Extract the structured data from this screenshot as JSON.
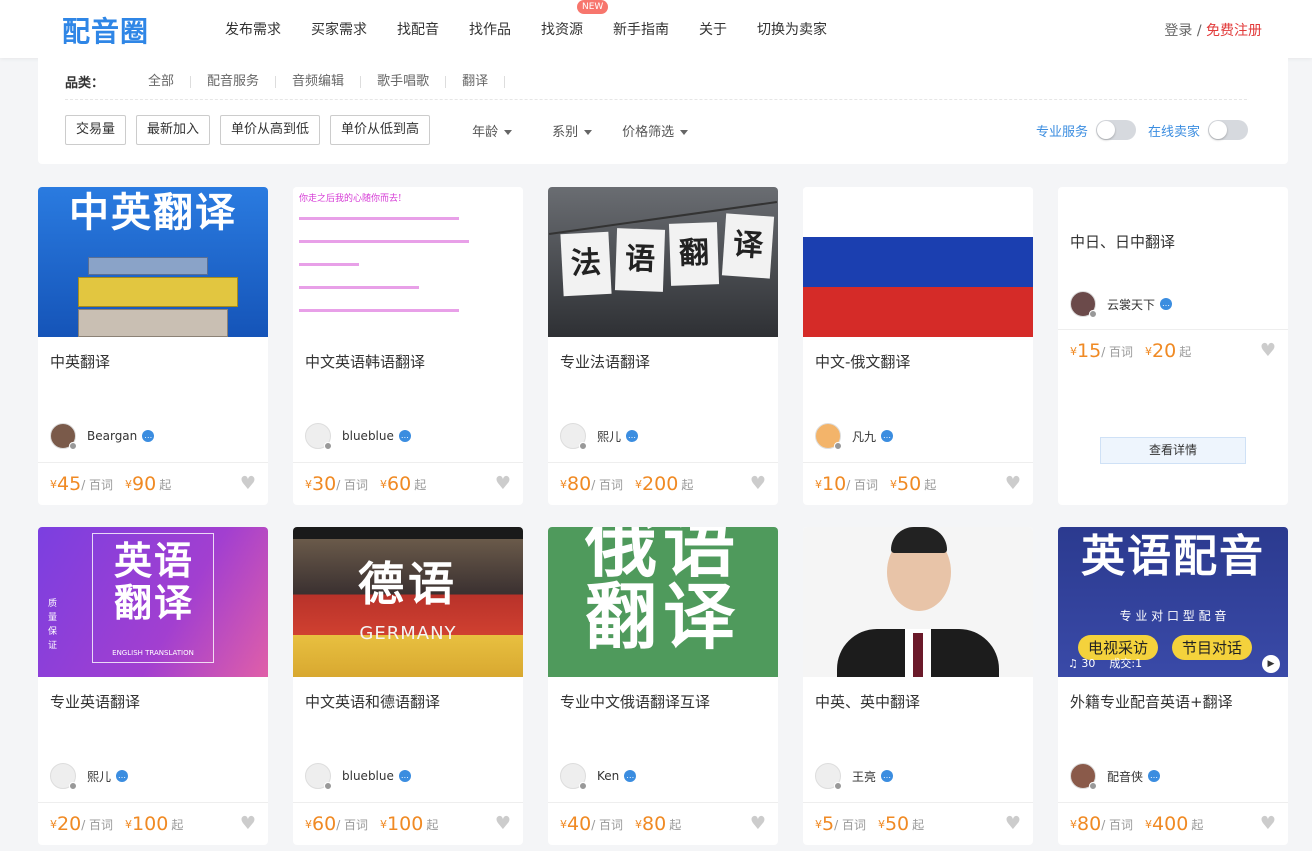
{
  "header": {
    "logo": "配音圈",
    "nav": [
      "发布需求",
      "买家需求",
      "找配音",
      "找作品",
      "找资源",
      "新手指南",
      "关于",
      "切换为卖家"
    ],
    "nav_badge": "NEW",
    "login": "登录",
    "separator": " / ",
    "register": "免费注册"
  },
  "filters": {
    "category_title": "品类：",
    "categories": [
      "全部",
      "配音服务",
      "音频编辑",
      "歌手唱歌",
      "翻译"
    ],
    "sort_buttons": [
      "交易量",
      "最新加入",
      "单价从高到低",
      "单价从低到高"
    ],
    "dropdowns": [
      "年龄",
      "系别",
      "价格筛选"
    ],
    "toggles": [
      "专业服务",
      "在线卖家"
    ]
  },
  "common": {
    "unit": "/ 百词",
    "qi": "起",
    "yen": "¥",
    "detail_button": "查看详情",
    "heart": "♥"
  },
  "cards": [
    {
      "title": "中英翻译",
      "seller": "Beargan",
      "price": "45",
      "start": "90",
      "thumb_text": "中英翻译",
      "thumb_bg": "#1d6fd3",
      "thumb_fg": "#ffffff"
    },
    {
      "title": "中文英语韩语翻译",
      "seller": "blueblue",
      "price": "30",
      "start": "60",
      "thumb_text": "你走之后我的心随你而去!",
      "thumb_bg": "#ffffff",
      "thumb_fg": "#d63ad6"
    },
    {
      "title": "专业法语翻译",
      "seller": "熙儿",
      "price": "80",
      "start": "200",
      "thumb_text": "法 语 翻 译",
      "thumb_bg": "#3d3f42",
      "thumb_fg": "#222222"
    },
    {
      "title": "中文-俄文翻译",
      "seller": "凡九",
      "price": "10",
      "start": "50",
      "thumb_text": "",
      "thumb_bg": "#ffffff",
      "thumb_fg": "#ffffff"
    },
    {
      "title": "中日、日中翻译",
      "seller": "云裳天下",
      "price": "15",
      "start": "20",
      "text_only": true
    },
    {
      "title": "专业英语翻译",
      "seller": "熙儿",
      "price": "20",
      "start": "100",
      "thumb_text": "英语翻译",
      "thumb_sub": "ENGLISH TRANSLATION",
      "thumb_side": "质量保证",
      "thumb_bg": "#8a3fd8",
      "thumb_fg": "#ffffff"
    },
    {
      "title": "中文英语和德语翻译",
      "seller": "blueblue",
      "price": "60",
      "start": "100",
      "thumb_text": "德语",
      "thumb_sub": "GERMANY",
      "thumb_bg": "#5a4a3a",
      "thumb_fg": "#ffffff"
    },
    {
      "title": "专业中文俄语翻译互译",
      "seller": "Ken",
      "price": "40",
      "start": "80",
      "thumb_text": "俄语翻译",
      "thumb_bg": "#4f9a5c",
      "thumb_fg": "#ffffff"
    },
    {
      "title": "中英、英中翻译",
      "seller": "王亮",
      "price": "5",
      "start": "50",
      "thumb_text": "",
      "thumb_bg": "#f2f2f2",
      "thumb_fg": "#333333"
    },
    {
      "title": "外籍专业配音英语+翻译",
      "seller": "配音侠",
      "price": "80",
      "start": "400",
      "thumb_text": "英语配音",
      "thumb_sub": "专 业 对 口 型 配 音",
      "thumb_tags": [
        "电视采访",
        "节目对话"
      ],
      "thumb_play": "30",
      "thumb_deals": "成交:1",
      "thumb_bg": "#2b3a8f",
      "thumb_fg": "#ffffff"
    }
  ]
}
